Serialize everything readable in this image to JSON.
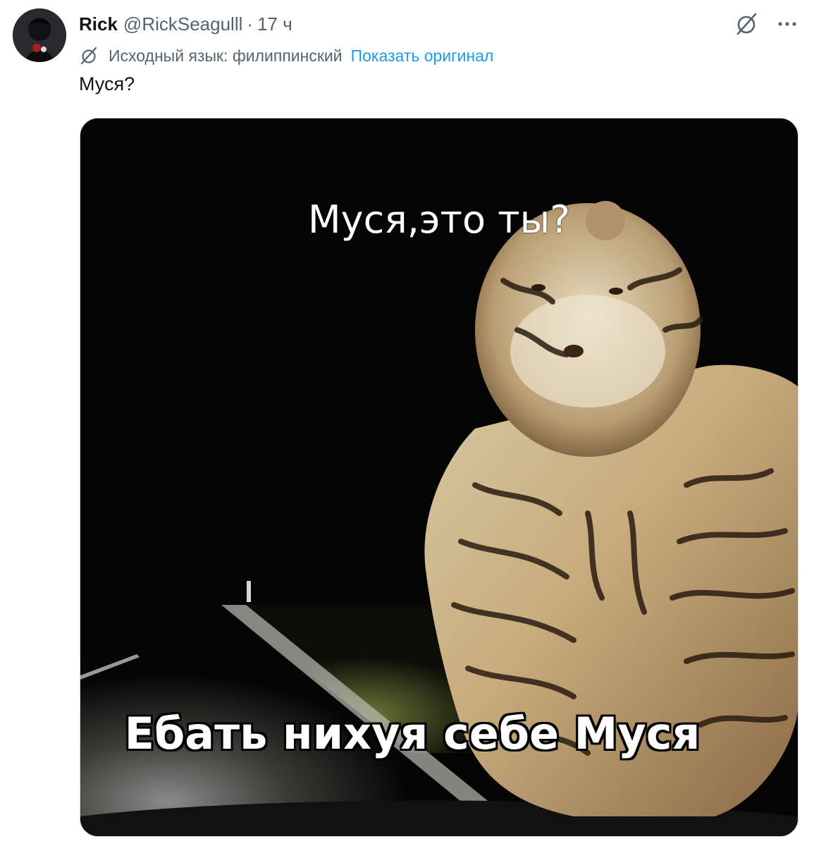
{
  "author": {
    "name": "Rick",
    "handle": "@RickSeagulll",
    "separator": "·",
    "time": "17 ч"
  },
  "actions": {
    "grok_icon": "grok-icon",
    "more_label": "···"
  },
  "translation": {
    "icon": "grok-translate-icon",
    "source_language_text": "Исходный язык: филиппинский",
    "show_original_label": "Показать оригинал"
  },
  "tweet": {
    "text": "Муся?"
  },
  "media": {
    "caption_top": "Муся,это ты?",
    "caption_bottom": "Ебать нихуя себе Муся"
  },
  "colors": {
    "text_primary": "#0f1419",
    "text_secondary": "#536471",
    "link": "#1d9bf0"
  }
}
